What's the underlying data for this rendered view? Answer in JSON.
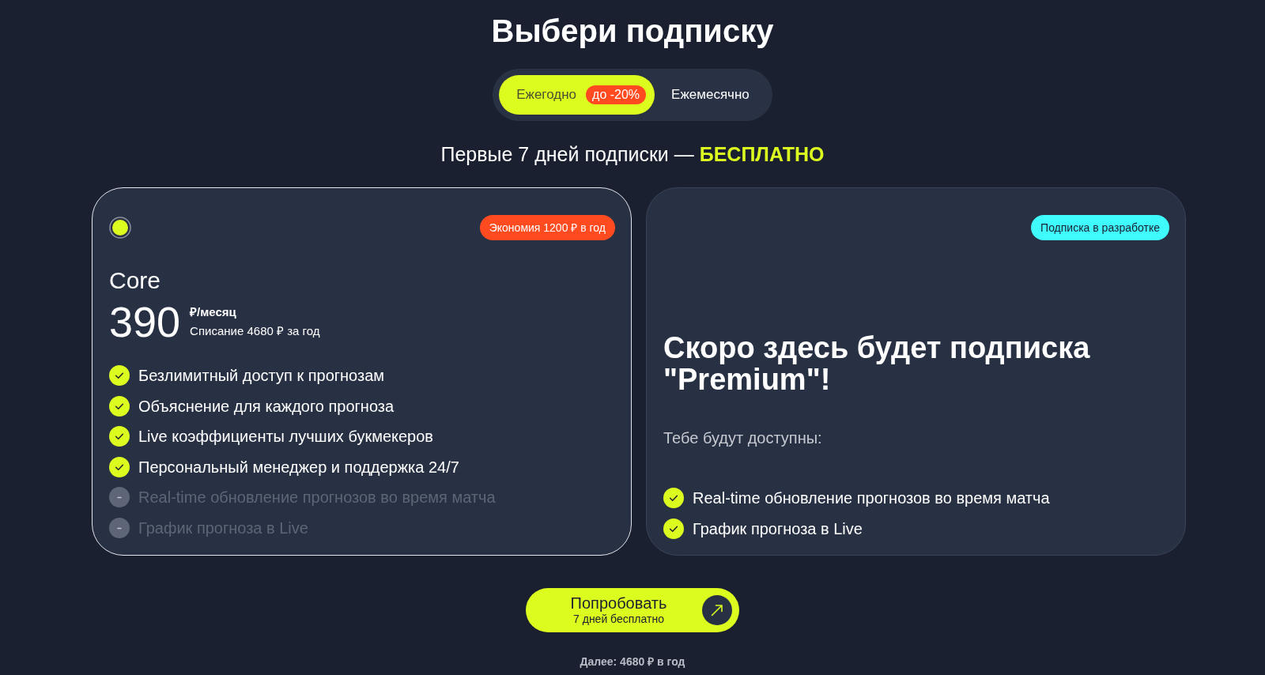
{
  "title": "Выбери подписку",
  "billing_tabs": [
    {
      "label": "Ежегодно",
      "badge": "до -20%",
      "selected": true
    },
    {
      "label": "Ежемесячно",
      "selected": false
    }
  ],
  "trial_note": "Первые 7 дней подписки — **БЕСПЛАТНО**",
  "plans": [
    {
      "kind": "plan",
      "selected": true,
      "badge": {
        "text": "Экономия 1200 ₽ в год",
        "color": "#ff4b1f"
      },
      "name": "Core",
      "price": "390",
      "period": "₽/месяц",
      "billing": "Списание 4680 ₽ за год",
      "features": [
        {
          "text": "Безлимитный доступ к прогнозам",
          "included": true
        },
        {
          "text": "Объяснение для каждого прогноза",
          "included": true
        },
        {
          "text": "Live коэффициенты лучших букмекеров",
          "included": true
        },
        {
          "text": "Персональный менеджер и поддержка 24/7",
          "included": true
        },
        {
          "text": "Real-time обновление прогнозов во время матча",
          "included": false
        },
        {
          "text": "График прогноза в Live",
          "included": false
        }
      ]
    },
    {
      "kind": "coming_soon",
      "selected": false,
      "badge": {
        "text": "Подписка в разработке",
        "color": "#40fbfb"
      },
      "heading": "Скоро здесь будет подписка \"Premium\"!",
      "intro": "Тебе будут доступны:",
      "features": [
        {
          "text": "Real-time обновление прогнозов во время матча",
          "included": true
        },
        {
          "text": "График прогноза в Live",
          "included": true
        }
      ]
    }
  ],
  "cta": {
    "label": "Попробовать",
    "sublabel": "7 дней бесплатно"
  },
  "footnote": "Далее: 4680 ₽ в год"
}
